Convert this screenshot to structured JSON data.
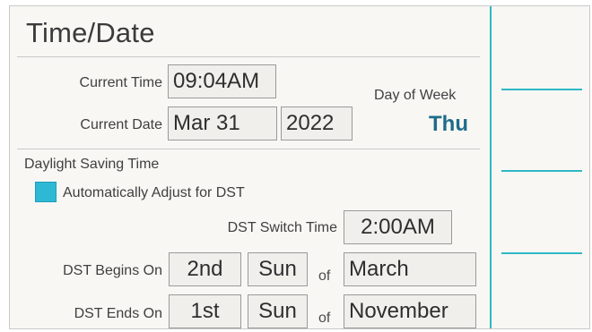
{
  "screen": {
    "title": "Time/Date"
  },
  "time_date": {
    "current_time_label": "Current Time",
    "current_time_value": "09:04AM",
    "current_date_label": "Current Date",
    "current_date_month_day": "Mar 31",
    "current_date_year": "2022",
    "day_of_week_label": "Day of Week",
    "day_of_week_value": "Thu"
  },
  "dst": {
    "section_label": "Daylight Saving Time",
    "auto_adjust_label": "Automatically Adjust for DST",
    "auto_adjust_checked": true,
    "switch_time_label": "DST Switch Time",
    "switch_time_value": "2:00AM",
    "begins_label": "DST Begins On",
    "begins_week": "2nd",
    "begins_day": "Sun",
    "begins_of": "of",
    "begins_month": "March",
    "ends_label": "DST Ends On",
    "ends_week": "1st",
    "ends_day": "Sun",
    "ends_of": "of",
    "ends_month": "November"
  },
  "colors": {
    "accent": "#2fb8c6",
    "checkbox": "#2db8d3",
    "day_of_week": "#1e6c8a"
  }
}
